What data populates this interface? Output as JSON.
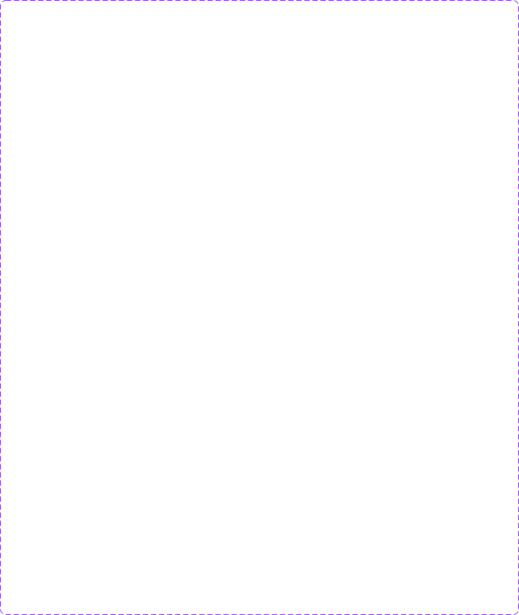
{
  "canvas": {
    "border_color": "#9a5bf0",
    "background_color": "#ffffff",
    "border_style": "dashed"
  }
}
